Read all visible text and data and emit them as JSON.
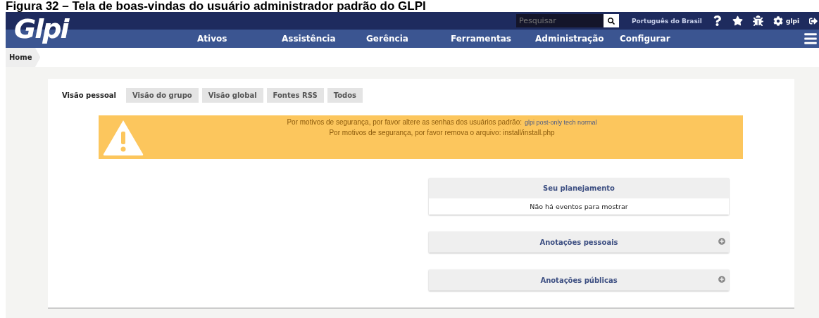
{
  "caption": "Figura 32 – Tela de boas-vindas do usuário administrador padrão do GLPI",
  "header": {
    "logo": "Glpi",
    "search": {
      "placeholder": "Pesquisar"
    },
    "language": "Português do Brasil",
    "user": "glpi",
    "menu": [
      "Ativos",
      "Assistência",
      "Gerência",
      "Ferramentas",
      "Administração",
      "Configurar"
    ]
  },
  "breadcrumb": [
    "Home"
  ],
  "tabs": [
    {
      "label": "Visão pessoal",
      "selected": true
    },
    {
      "label": "Visão do grupo",
      "selected": false
    },
    {
      "label": "Visão global",
      "selected": false
    },
    {
      "label": "Fontes RSS",
      "selected": false
    },
    {
      "label": "Todos",
      "selected": false
    }
  ],
  "alert": {
    "lines": [
      {
        "text": "Por motivos de segurança, por favor altere as senhas dos usuários padrão:",
        "link": "glpi post-only tech normal"
      },
      {
        "text": "Por motivos de segurança, por favor remova o arquivo: install/install.php"
      }
    ]
  },
  "panels": [
    {
      "title": "Seu planejamento",
      "kind": "list",
      "body": "Não há eventos para mostrar"
    },
    {
      "title": "Anotações pessoais",
      "kind": "collapsed"
    },
    {
      "title": "Anotações públicas",
      "kind": "collapsed"
    }
  ]
}
